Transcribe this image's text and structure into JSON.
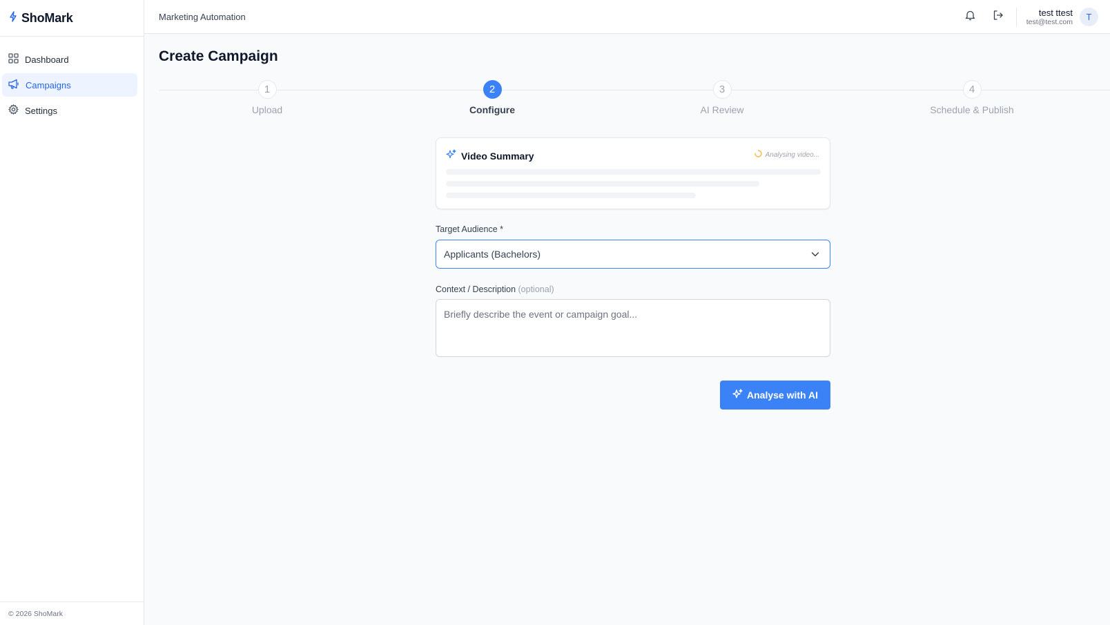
{
  "brand": {
    "name": "ShoMark",
    "icon": "bolt-icon",
    "accent": "#2563eb"
  },
  "sidebar": {
    "items": [
      {
        "label": "Dashboard",
        "icon": "grid-icon",
        "active": false
      },
      {
        "label": "Campaigns",
        "icon": "megaphone-icon",
        "active": true
      },
      {
        "label": "Settings",
        "icon": "gear-icon",
        "active": false
      }
    ],
    "footer": "© 2026 ShoMark"
  },
  "header": {
    "title": "Marketing Automation",
    "user": {
      "name": "test ttest",
      "email": "test@test.com",
      "initial": "T"
    }
  },
  "page": {
    "title": "Create Campaign"
  },
  "stepper": {
    "current": 2,
    "steps": [
      {
        "number": "1",
        "label": "Upload"
      },
      {
        "number": "2",
        "label": "Configure"
      },
      {
        "number": "3",
        "label": "AI Review"
      },
      {
        "number": "4",
        "label": "Schedule & Publish"
      }
    ]
  },
  "summary": {
    "title": "Video Summary",
    "status": "Analysing video..."
  },
  "form": {
    "audience_label": "Target Audience *",
    "audience_value": "Applicants (Bachelors)",
    "context_label": "Context / Description",
    "context_optional": "(optional)",
    "context_placeholder": "Briefly describe the event or campaign goal...",
    "context_value": ""
  },
  "actions": {
    "analyse_label": "Analyse with AI"
  },
  "colors": {
    "primary": "#3b82f6",
    "border": "#e5e7eb",
    "muted": "#9ca3af"
  }
}
